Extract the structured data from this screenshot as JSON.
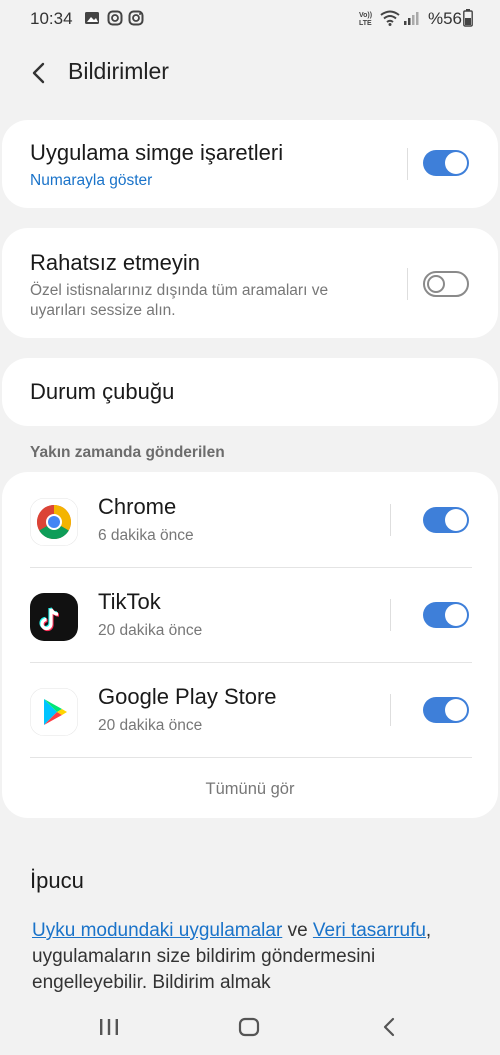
{
  "status_bar": {
    "time": "10:34",
    "battery": "%56",
    "icons": [
      "image-icon",
      "instagram-icon",
      "instagram-icon",
      "volte-icon",
      "wifi-icon",
      "signal-icon",
      "battery-icon"
    ]
  },
  "header": {
    "title": "Bildirimler",
    "back_icon": "chevron-left-icon"
  },
  "badges": {
    "title": "Uygulama simge işaretleri",
    "subtitle": "Numarayla göster",
    "enabled": true
  },
  "dnd": {
    "title": "Rahatsız etmeyin",
    "description": "Özel istisnalarınız dışında tüm aramaları ve uyarıları sessize alın.",
    "enabled": false
  },
  "status_bar_item": {
    "title": "Durum çubuğu"
  },
  "recent": {
    "label": "Yakın zamanda gönderilen",
    "apps": [
      {
        "name": "Chrome",
        "time": "6 dakika önce",
        "icon": "chrome-icon",
        "enabled": true
      },
      {
        "name": "TikTok",
        "time": "20 dakika önce",
        "icon": "tiktok-icon",
        "enabled": true
      },
      {
        "name": "Google Play Store",
        "time": "20 dakika önce",
        "icon": "play-store-icon",
        "enabled": true
      }
    ],
    "see_all": "Tümünü gör"
  },
  "tip": {
    "title": "İpucu",
    "link1": "Uyku modundaki uygulamalar",
    "connector": " ve ",
    "link2": "Veri tasarrufu",
    "rest": ", uygulamaların size bildirim göndermesini engelleyebilir. Bildirim almak"
  },
  "colors": {
    "accent": "#1a73c9",
    "toggle_on": "#3e7fd9",
    "background": "#f2f2f2"
  }
}
